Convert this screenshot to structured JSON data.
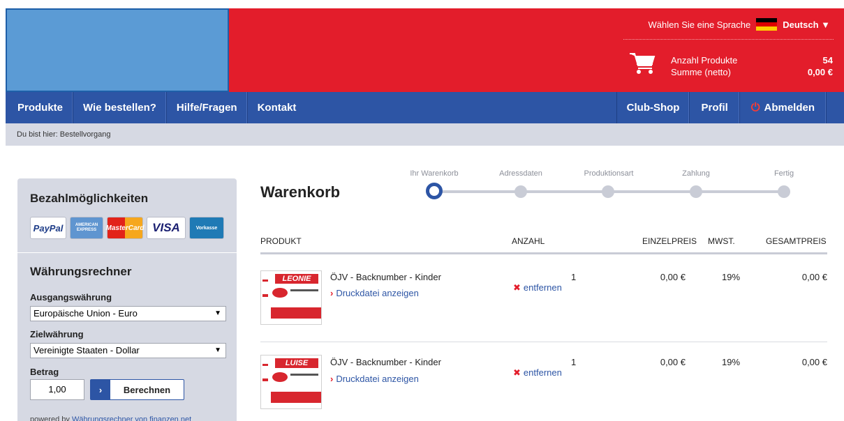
{
  "header": {
    "language_prompt": "Wählen Sie eine Sprache",
    "language": "Deutsch ▼",
    "cart": {
      "products_label": "Anzahl Produkte",
      "sum_label": "Summe (netto)",
      "products_count": "54",
      "sum_value": "0,00 €"
    }
  },
  "nav": {
    "items": [
      "Produkte",
      "Wie bestellen?",
      "Hilfe/Fragen",
      "Kontakt"
    ],
    "right_items": [
      "Club-Shop",
      "Profil",
      "Abmelden"
    ]
  },
  "breadcrumb": "Du bist hier: Bestellvorgang",
  "sidebar": {
    "payment_title": "Bezahlmöglichkeiten",
    "payment_methods": [
      "PayPal",
      "AMERICAN EXPRESS",
      "MasterCard",
      "VISA",
      "Vorkasse"
    ],
    "converter_title": "Währungsrechner",
    "source_label": "Ausgangswährung",
    "source_value": "Europäische Union - Euro",
    "target_label": "Zielwährung",
    "target_value": "Vereinigte Staaten - Dollar",
    "amount_label": "Betrag",
    "amount_value": "1,00",
    "calc_button": "Berechnen",
    "powered_prefix": "powered by",
    "powered_link": "Währungsrechner von finanzen.net"
  },
  "main": {
    "title": "Warenkorb",
    "steps": [
      "Ihr Warenkorb",
      "Adressdaten",
      "Produktionsart",
      "Zahlung",
      "Fertig"
    ],
    "columns": {
      "product": "PRODUKT",
      "quantity": "ANZAHL",
      "unit_price": "EINZELPREIS",
      "vat": "MWST.",
      "total": "GESAMTPREIS"
    },
    "items": [
      {
        "thumb_name": "LEONIE",
        "name": "ÖJV - Backnumber - Kinder",
        "link": "Druckdatei anzeigen",
        "quantity": "1",
        "remove": "entfernen",
        "unit_price": "0,00 €",
        "vat": "19%",
        "total": "0,00 €"
      },
      {
        "thumb_name": "LUISE",
        "name": "ÖJV - Backnumber - Kinder",
        "link": "Druckdatei anzeigen",
        "quantity": "1",
        "remove": "entfernen",
        "unit_price": "0,00 €",
        "vat": "19%",
        "total": "0,00 €"
      }
    ]
  },
  "colors": {
    "brand_red": "#e31d2b",
    "nav_blue": "#2d55a5",
    "sidebar_gray": "#d6d9e3"
  }
}
